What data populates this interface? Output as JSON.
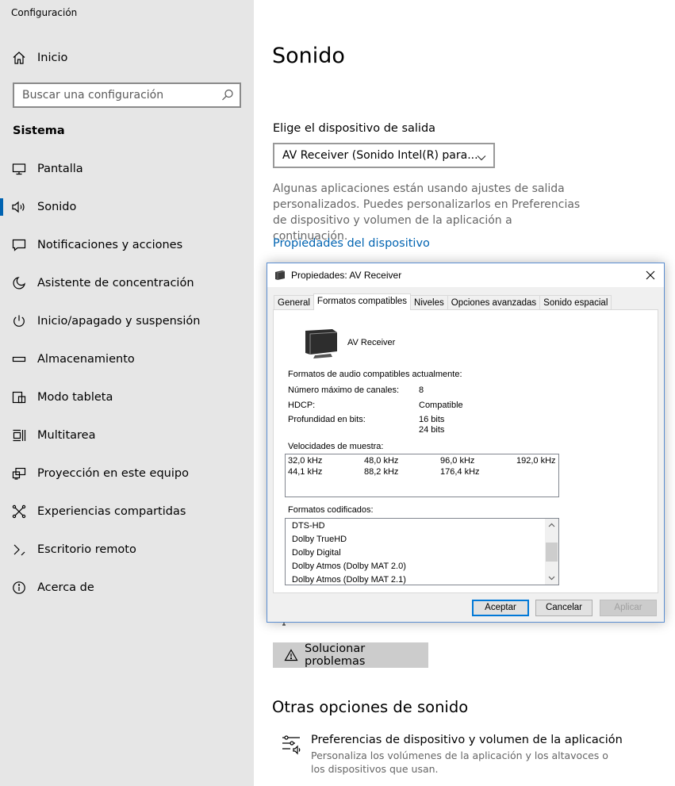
{
  "app": {
    "title": "Configuración"
  },
  "sidebar": {
    "home_label": "Inicio",
    "search_placeholder": "Buscar una configuración",
    "section_title": "Sistema",
    "items": [
      {
        "label": "Pantalla",
        "icon": "monitor-icon"
      },
      {
        "label": "Sonido",
        "icon": "speaker-icon",
        "active": true
      },
      {
        "label": "Notificaciones y acciones",
        "icon": "notification-icon"
      },
      {
        "label": "Asistente de concentración",
        "icon": "moon-icon"
      },
      {
        "label": "Inicio/apagado y suspensión",
        "icon": "power-icon"
      },
      {
        "label": "Almacenamiento",
        "icon": "storage-icon"
      },
      {
        "label": "Modo tableta",
        "icon": "tablet-icon"
      },
      {
        "label": "Multitarea",
        "icon": "multitask-icon"
      },
      {
        "label": "Proyección en este equipo",
        "icon": "projection-icon"
      },
      {
        "label": "Experiencias compartidas",
        "icon": "shared-icon"
      },
      {
        "label": "Escritorio remoto",
        "icon": "remote-desktop-icon"
      },
      {
        "label": "Acerca de",
        "icon": "info-icon"
      }
    ]
  },
  "main": {
    "title": "Sonido",
    "output_label": "Elige el dispositivo de salida",
    "output_device": "AV Receiver (Sonido Intel(R) para...",
    "description": "Algunas aplicaciones están usando ajustes de salida personalizados. Puedes personalizarlos en Preferencias de dispositivo y volumen de la aplicación a continuación.",
    "device_properties_link": "Propiedades del dispositivo",
    "troubleshoot_label": "Solucionar problemas",
    "other_options_title": "Otras opciones de sonido",
    "app_prefs_title": "Preferencias de dispositivo y volumen de la aplicación",
    "app_prefs_desc": "Personaliza los volúmenes de la aplicación y los altavoces o los dispositivos que usan."
  },
  "dialog": {
    "title": "Propiedades: AV Receiver",
    "tabs": [
      "General",
      "Formatos compatibles",
      "Niveles",
      "Opciones avanzadas",
      "Sonido espacial"
    ],
    "active_tab": "Formatos compatibles",
    "device_name": "AV Receiver",
    "formats_heading": "Formatos de audio compatibles actualmente:",
    "max_channels_label": "Número máximo de canales:",
    "max_channels_value": "8",
    "hdcp_label": "HDCP:",
    "hdcp_value": "Compatible",
    "bit_depth_label": "Profundidad en bits:",
    "bit_depths": [
      "16 bits",
      "24 bits"
    ],
    "sample_rates_label": "Velocidades de muestra:",
    "sample_rates": [
      "32,0 kHz",
      "48,0 kHz",
      "96,0 kHz",
      "192,0 kHz",
      "44,1 kHz",
      "88,2 kHz",
      "176,4 kHz"
    ],
    "encoded_formats_label": "Formatos codificados:",
    "encoded_formats": [
      "DTS-HD",
      "Dolby TrueHD",
      "Dolby Digital",
      "Dolby Atmos (Dolby MAT 2.0)",
      "Dolby Atmos (Dolby MAT 2.1)"
    ],
    "buttons": {
      "ok": "Aceptar",
      "cancel": "Cancelar",
      "apply": "Aplicar"
    }
  }
}
